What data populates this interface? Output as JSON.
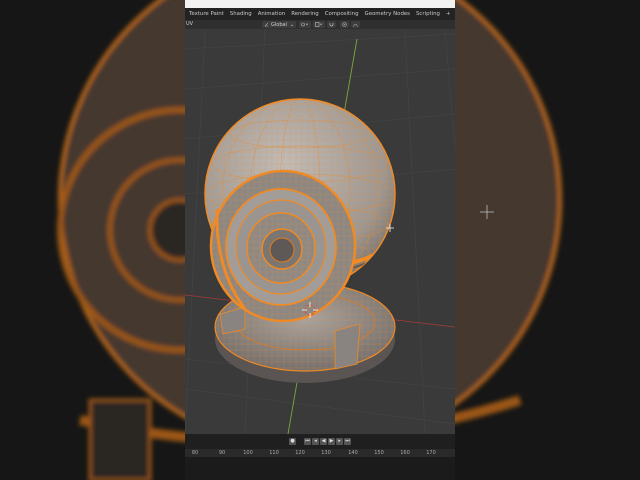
{
  "workspace_tabs": [
    "Texture Paint",
    "Shading",
    "Animation",
    "Rendering",
    "Compositing",
    "Geometry Nodes",
    "Scripting",
    "+"
  ],
  "header": {
    "editor_label": "UV",
    "transform_orientation": "Global"
  },
  "timeline": {
    "frame_ticks": [
      "80",
      "90",
      "100",
      "110",
      "120",
      "130",
      "140",
      "150",
      "160",
      "170"
    ]
  },
  "colors": {
    "selection": "#f08a24",
    "mesh_surface": "#a09a96",
    "background": "#3a3a3a",
    "axis_y": "#7aa83a",
    "axis_x": "#a83a3a"
  },
  "icons": {
    "record": "record-icon",
    "jump_start": "jump-start-icon",
    "step_back": "step-back-icon",
    "play_reverse": "play-reverse-icon",
    "play": "play-icon",
    "step_forward": "step-forward-icon",
    "jump_end": "jump-end-icon",
    "cursor_3d": "3d-cursor-icon"
  }
}
